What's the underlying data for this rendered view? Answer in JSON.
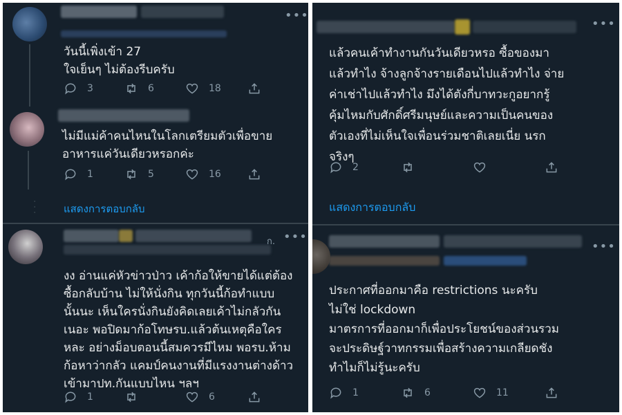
{
  "left": {
    "tweet1": {
      "text": "วันนี้เพิ่งเข้า 27\nใจเย็นๆ ไม่ต้องรีบครับ",
      "replies": "3",
      "retweets": "6",
      "likes": "18"
    },
    "tweet2": {
      "text": "ไม่มีแม่ค้าคนไหนในโลกเตรียมตัวเพื่อขาย\nอาหารแค่วันเดียวหรอกค่ะ",
      "replies": "1",
      "retweets": "5",
      "likes": "16"
    },
    "show_replies": "แสดงการตอบกลับ",
    "tweet3": {
      "header_suffix": "ก.",
      "text": "งง อ่านแค่หัวข่าวป่าว เค้าก้อให้ขายได้แต่ต้อง\nซื้อกลับบ้าน ไม่ให้นั่งกิน ทุกวันนี้ก้อทำแบบ\nนั้นนะ เห็นใครนั่งกินยังคิดเลยเค้าไม่กลัวกัน\nเนอะ พอปิดมาก้อโทษรบ.แล้วต้นเหตุคือใคร\nหละ อย่างม็อบตอนนี้สมควรมีไหม พอรบ.ห้าม\nก้อหาว่ากลัว แคมป์คนงานที่มีแรงงานต่างด้าว\nเข้ามาปท.กันแบบไหน ฯลฯ",
      "replies": "1",
      "retweets": "",
      "likes": "6"
    }
  },
  "right": {
    "tweet1": {
      "text": "แล้วคนเค้าทำงานกันวันเดียวหรอ ซื้อของมา\nแล้วทำไง จ้างลูกจ้างรายเดือนไปแล้วทำไง จ่าย\nค่าเช่าไปแล้วทำไง มึงได้ตังกี่บาทวะกูอยากรู้\nคุ้มไหมกับศักดิ์ศรีมนุษย์และความเป็นคนของ\nตัวเองที่ไม่เห็นใจเพื่อนร่วมชาติเลยเนี่ย นรก\nจริงๆ",
      "replies": "2",
      "retweets": "",
      "likes": ""
    },
    "show_replies": "แสดงการตอบกลับ",
    "tweet2": {
      "text": "ประกาศที่ออกมาคือ restrictions นะครับ\nไม่ใช่ lockdown\nมาตรการที่ออกมาก็เพื่อประโยชน์ของส่วนรวม\nจะประดิษฐ์วาทกรรมเพื่อสร้างความเกลียดชัง\nทำไมก็ไม่รู้นะครับ",
      "replies": "1",
      "retweets": "6",
      "likes": "11"
    }
  },
  "more_label": "•••",
  "colors": {
    "background": "#15202b",
    "text": "#e7e9ea",
    "muted": "#8899a6",
    "link": "#1d9bf0",
    "divider": "#38444d"
  },
  "icons": [
    "reply-icon",
    "retweet-icon",
    "like-icon",
    "share-icon",
    "more-icon"
  ]
}
